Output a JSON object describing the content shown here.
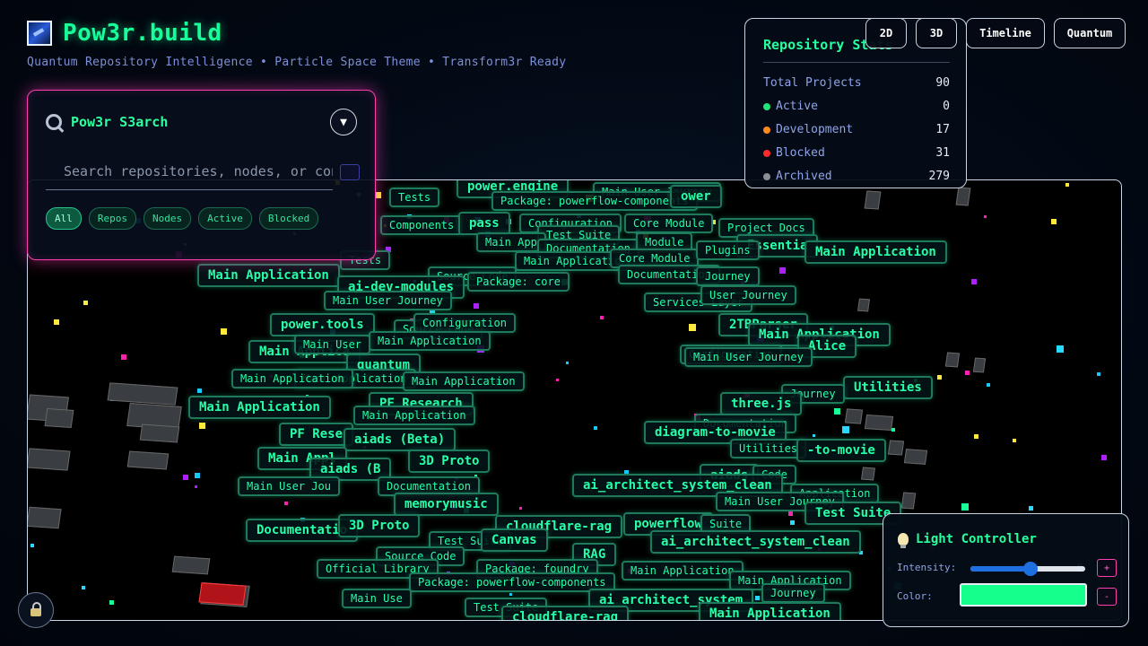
{
  "app": {
    "title": "Pow3r.build",
    "subtitle": "Quantum Repository Intelligence • Particle Space Theme • Transform3r Ready"
  },
  "search": {
    "title": "Pow3r S3arch",
    "placeholder": "Search repositories, nodes, or content",
    "collapse_label": "▼",
    "filters": [
      {
        "label": "All",
        "active": true
      },
      {
        "label": "Repos",
        "active": false
      },
      {
        "label": "Nodes",
        "active": false
      },
      {
        "label": "Active",
        "active": false
      },
      {
        "label": "Blocked",
        "active": false
      }
    ]
  },
  "stats": {
    "title": "Repository Stats",
    "rows": [
      {
        "label": "Total Projects",
        "value": "90",
        "color": ""
      },
      {
        "label": "Active",
        "value": "0",
        "color": "#22e27a"
      },
      {
        "label": "Development",
        "value": "17",
        "color": "#ff8a1e"
      },
      {
        "label": "Blocked",
        "value": "31",
        "color": "#ff2a2a"
      },
      {
        "label": "Archived",
        "value": "279",
        "color": "#8a8f96"
      }
    ]
  },
  "view_modes": [
    "2D",
    "3D",
    "Timeline",
    "Quantum"
  ],
  "light": {
    "title": "Light Controller",
    "intensity_label": "Intensity:",
    "color_label": "Color:",
    "intensity": 0.52,
    "color": "#14ff8c",
    "plus_label": "+",
    "minus_label": "-"
  },
  "nodes": [
    {
      "label": "power.engine",
      "big": true
    },
    {
      "label": "Main User Journey",
      "big": false
    },
    {
      "label": "Tests",
      "big": false
    },
    {
      "label": "Package: powerflow-components",
      "big": false
    },
    {
      "label": "ower",
      "big": true
    },
    {
      "label": "Configuration",
      "big": false
    },
    {
      "label": "Core Module",
      "big": false
    },
    {
      "label": "Project Docs",
      "big": false
    },
    {
      "label": "Components",
      "big": false
    },
    {
      "label": "pass",
      "big": true
    },
    {
      "label": "Test Suite",
      "big": false
    },
    {
      "label": "Main App",
      "big": false
    },
    {
      "label": "Documentation",
      "big": false
    },
    {
      "label": "Module",
      "big": false
    },
    {
      "label": "Essentia",
      "big": true
    },
    {
      "label": "Main Application",
      "big": true
    },
    {
      "label": "Main Applicatio",
      "big": false
    },
    {
      "label": "Core Module",
      "big": false
    },
    {
      "label": "Plugins",
      "big": false
    },
    {
      "label": "Main Application",
      "big": true
    },
    {
      "label": "Tests",
      "big": false
    },
    {
      "label": "Source Code",
      "big": false
    },
    {
      "label": "Documentation",
      "big": false
    },
    {
      "label": "Journey",
      "big": false
    },
    {
      "label": "ai-dev-modules",
      "big": true
    },
    {
      "label": "Package: core",
      "big": false
    },
    {
      "label": "Main User Journey",
      "big": false
    },
    {
      "label": "Services Layer",
      "big": false
    },
    {
      "label": "User Journey",
      "big": false
    },
    {
      "label": "power.tools",
      "big": true
    },
    {
      "label": "Source Code",
      "big": false
    },
    {
      "label": "Configuration",
      "big": false
    },
    {
      "label": "2TBParser",
      "big": true
    },
    {
      "label": "Main Application",
      "big": true
    },
    {
      "label": "Main Application",
      "big": false
    },
    {
      "label": "Main Applica",
      "big": true
    },
    {
      "label": "Alice",
      "big": true
    },
    {
      "label": "Configuration",
      "big": false
    },
    {
      "label": "Main User Journey",
      "big": false
    },
    {
      "label": "quantum",
      "big": true
    },
    {
      "label": "Main User",
      "big": false
    },
    {
      "label": "Main Application",
      "big": false
    },
    {
      "label": "Main Application",
      "big": false
    },
    {
      "label": "Utilities",
      "big": true
    },
    {
      "label": "Main Application",
      "big": false
    },
    {
      "label": "Journey",
      "big": false
    },
    {
      "label": "PF Research",
      "big": true
    },
    {
      "label": "Main Application",
      "big": true
    },
    {
      "label": "three.js",
      "big": true
    },
    {
      "label": "Main Application",
      "big": false
    },
    {
      "label": "Documentation",
      "big": false
    },
    {
      "label": "PF Rese",
      "big": true
    },
    {
      "label": "aiads (Beta)",
      "big": true
    },
    {
      "label": "diagram-to-movie",
      "big": true
    },
    {
      "label": "Utilities",
      "big": false
    },
    {
      "label": "-to-movie",
      "big": true
    },
    {
      "label": "Main Appl",
      "big": true
    },
    {
      "label": "3D Proto",
      "big": true
    },
    {
      "label": "aiads",
      "big": true
    },
    {
      "label": "Code",
      "big": false
    },
    {
      "label": "aiads (B",
      "big": true
    },
    {
      "label": "Documentation",
      "big": false
    },
    {
      "label": "ai_architect_system_clean",
      "big": true
    },
    {
      "label": "Main User Jou",
      "big": false
    },
    {
      "label": "Application",
      "big": false
    },
    {
      "label": "memorymusic",
      "big": true
    },
    {
      "label": "Main User Journey",
      "big": false
    },
    {
      "label": "Test Suite",
      "big": true
    },
    {
      "label": "Documentatio",
      "big": true
    },
    {
      "label": "3D Proto",
      "big": true
    },
    {
      "label": "cloudflare-rag",
      "big": true
    },
    {
      "label": "powerflow",
      "big": true
    },
    {
      "label": "Suite",
      "big": false
    },
    {
      "label": "Test Suite",
      "big": false
    },
    {
      "label": "Canvas",
      "big": true
    },
    {
      "label": "ai_architect_system_clean",
      "big": true
    },
    {
      "label": "Source Code",
      "big": false
    },
    {
      "label": "RAG",
      "big": true
    },
    {
      "label": "Official Library",
      "big": false
    },
    {
      "label": "Package: foundry",
      "big": false
    },
    {
      "label": "Main Application",
      "big": false
    },
    {
      "label": "Package: powerflow-components",
      "big": false
    },
    {
      "label": "Main Application",
      "big": false
    },
    {
      "label": "Main Use",
      "big": false
    },
    {
      "label": "Journey",
      "big": false
    },
    {
      "label": "ai_architect_system",
      "big": true
    },
    {
      "label": "Test Suite",
      "big": false
    },
    {
      "label": "Main Application",
      "big": true
    },
    {
      "label": "cloudflare-rag",
      "big": true
    }
  ]
}
